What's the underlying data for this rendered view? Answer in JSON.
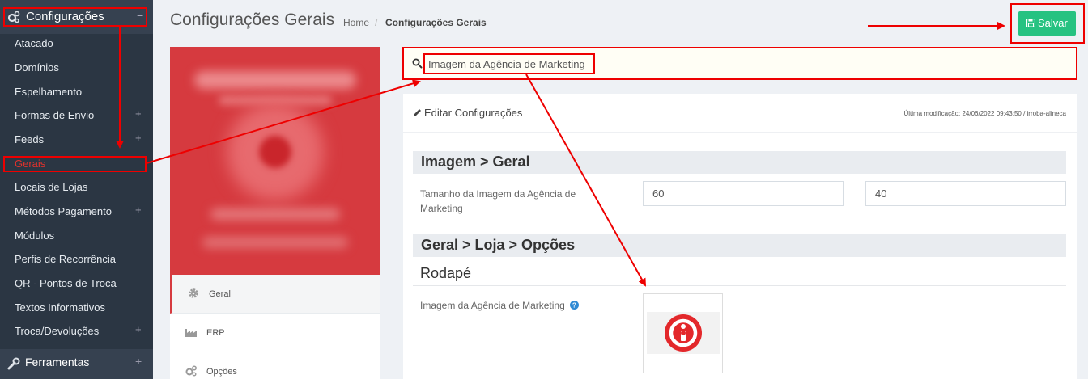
{
  "sidebar": {
    "section_title": "Configurações",
    "collapse_symbol": "−",
    "items": [
      {
        "label": "Atacado",
        "expandable": false
      },
      {
        "label": "Domínios",
        "expandable": false
      },
      {
        "label": "Espelhamento",
        "expandable": false
      },
      {
        "label": "Formas de Envio",
        "expandable": true
      },
      {
        "label": "Feeds",
        "expandable": true
      },
      {
        "label": "Gerais",
        "expandable": false,
        "active": true
      },
      {
        "label": "Locais de Lojas",
        "expandable": false
      },
      {
        "label": "Métodos Pagamento",
        "expandable": true
      },
      {
        "label": "Módulos",
        "expandable": false
      },
      {
        "label": "Perfis de Recorrência",
        "expandable": false
      },
      {
        "label": "QR - Pontos de Troca",
        "expandable": false
      },
      {
        "label": "Textos Informativos",
        "expandable": false
      },
      {
        "label": "Troca/Devoluções",
        "expandable": true
      }
    ],
    "expand_symbol": "+",
    "footer_label": "Ferramentas"
  },
  "header": {
    "title": "Configurações Gerais",
    "breadcrumb_home": "Home",
    "breadcrumb_sep": "/",
    "breadcrumb_current": "Configurações Gerais",
    "save_label": "Salvar"
  },
  "left_menu": {
    "items": [
      "Geral",
      "ERP",
      "Opções"
    ]
  },
  "search": {
    "value": "Imagem da Agência de Marketing"
  },
  "panel": {
    "title": "Editar Configurações",
    "last_modified": "Última modificação: 24/06/2022 09:43:50 / irroba-alineca",
    "section1_title": "Imagem > Geral",
    "size_label": "Tamanho da Imagem da Agência de Marketing",
    "width_value": "60",
    "height_value": "40",
    "section2_title": "Geral > Loja > Opções",
    "subsection_title": "Rodapé",
    "image_label": "Imagem da Agência de Marketing"
  },
  "colors": {
    "sidebar_bg": "#2b3643",
    "accent_red": "#d63a3f",
    "save_green": "#26c281",
    "annotation_red": "#ee0000"
  }
}
